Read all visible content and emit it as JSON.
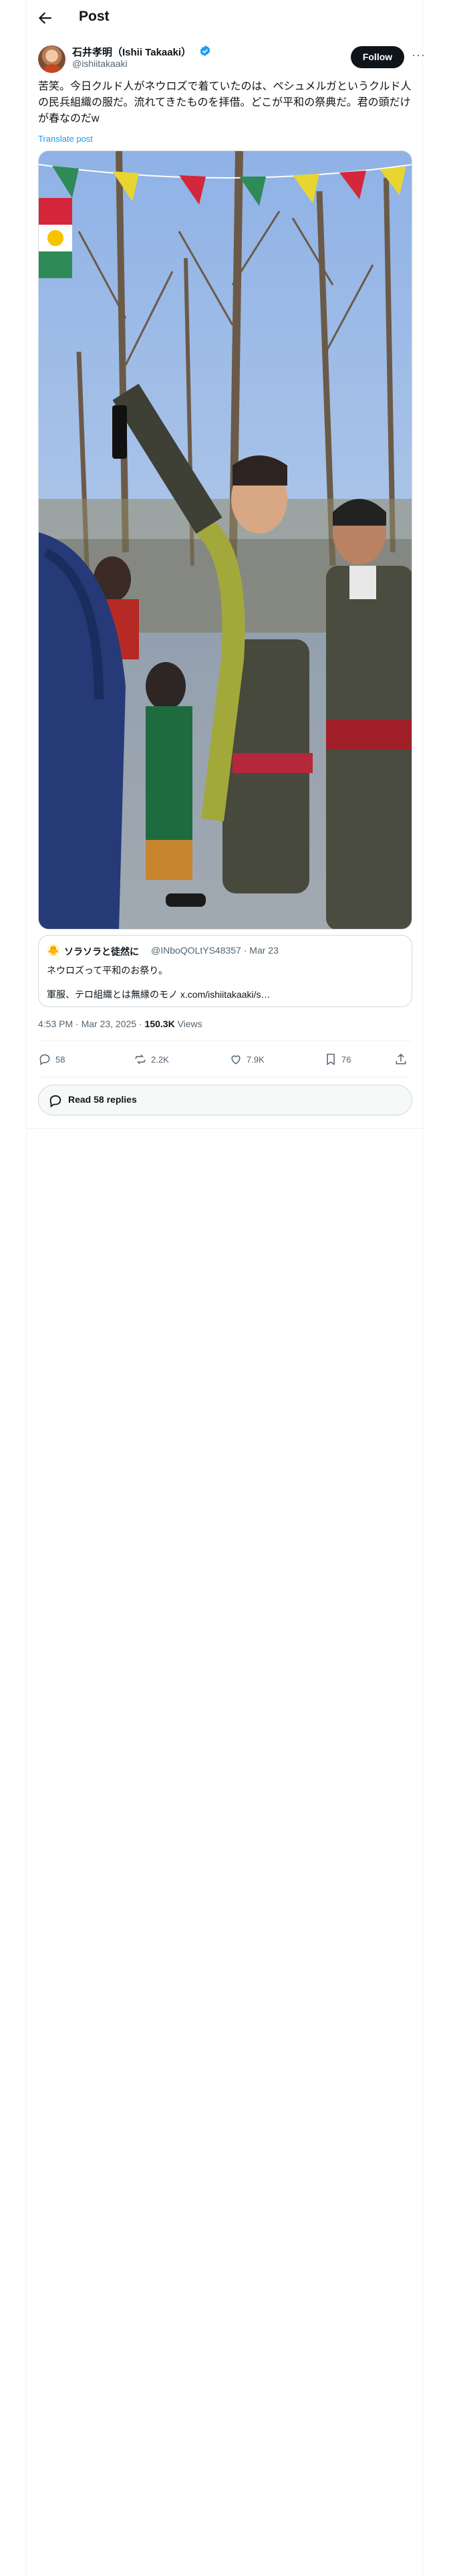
{
  "header": {
    "title": "Post"
  },
  "author": {
    "display_name": "石井孝明（Ishii Takaaki）",
    "handle": "@ishiitakaaki",
    "verified": true,
    "avatar_icon": "profile-photo"
  },
  "follow_button": {
    "label": "Follow"
  },
  "more_button": {
    "label": "···"
  },
  "tweet": {
    "text": "苦笑。今日クルド人がネウロズで着ていたのは、ペシュメルガというクルド人の民兵組織の服だ。流れてきたものを拝借。どこが平和の祭典だ。君の頭だけが春なのだw",
    "translate_label": "Translate post"
  },
  "quote": {
    "display_name": "ソラソラと徒然に",
    "meta": "@INboQOLtYS48357 · Mar 23",
    "line1": "ネウロズって平和のお祭り。",
    "line2": "軍服、テロ組織とは無縁のモノ x.com/ishiitakaaki/s…",
    "avatar_emoji": "🐥"
  },
  "timestamp": {
    "time": "4:53 PM · Mar 23, 2025 · ",
    "views_count": "150.3K",
    "views_label": " Views"
  },
  "actions": {
    "replies": "58",
    "reposts": "2.2K",
    "likes": "7.9K",
    "bookmarks": "76"
  },
  "read_replies": {
    "label": "Read 58 replies"
  },
  "colors": {
    "accent": "#1d9bf0",
    "text": "#0f1419",
    "muted": "#536471",
    "border": "#cfd9de"
  }
}
